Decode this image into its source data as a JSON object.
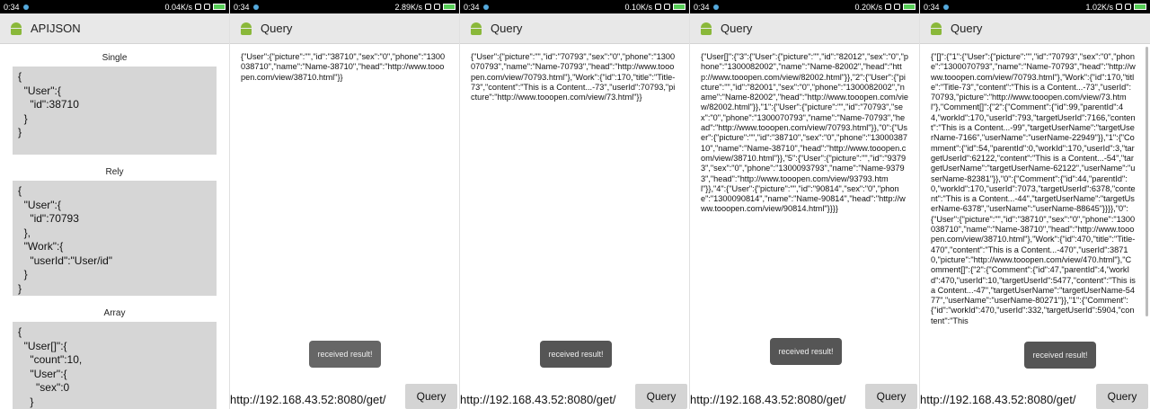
{
  "status": [
    {
      "time": "0:34",
      "net": "0.04K/s"
    },
    {
      "time": "0:34",
      "net": "2.89K/s"
    },
    {
      "time": "0:34",
      "net": "0.10K/s"
    },
    {
      "time": "0:34",
      "net": "0.20K/s"
    },
    {
      "time": "0:34",
      "net": "1.02K/s"
    }
  ],
  "main": {
    "title": "APIJSON",
    "sections": [
      {
        "label": "Single",
        "code": "{\n  \"User\":{\n    \"id\":38710\n  }\n}"
      },
      {
        "label": "Rely",
        "code": "{\n  \"User\":{\n    \"id\":70793\n  },\n  \"Work\":{\n    \"userId\":\"User/id\"\n  }\n}"
      },
      {
        "label": "Array",
        "code": "{\n  \"User[]\":{\n    \"count\":10,\n    \"User\":{\n      \"sex\":0\n    }"
      }
    ]
  },
  "query_screens": [
    {
      "title": "Query",
      "result": "{\"User\":{\"picture\":\"\",\"id\":\"38710\",\"sex\":\"0\",\"phone\":\"1300038710\",\"name\":\"Name-38710\",\"head\":\"http://www.tooopen.com/view/38710.html\"}}",
      "toast": "received result!",
      "url": "http://192.168.43.52:8080/get/",
      "button": "Query"
    },
    {
      "title": "Query",
      "result": "{\"User\":{\"picture\":\"\",\"id\":\"70793\",\"sex\":\"0\",\"phone\":\"1300070793\",\"name\":\"Name-70793\",\"head\":\"http://www.tooopen.com/view/70793.html\"},\"Work\":{\"id\":170,\"title\":\"Title-73\",\"content\":\"This is a Content...-73\",\"userId\":70793,\"picture\":\"http://www.tooopen.com/view/73.html\"}}",
      "toast": "received result!",
      "url": "http://192.168.43.52:8080/get/",
      "button": "Query"
    },
    {
      "title": "Query",
      "result": "{\"User[]\":{\"3\":{\"User\":{\"picture\":\"\",\"id\":\"82012\",\"sex\":\"0\",\"phone\":\"1300082002\",\"name\":\"Name-82002\",\"head\":\"http://www.tooopen.com/view/82002.html\"}},\"2\":{\"User\":{\"picture\":\"\",\"id\":\"82001\",\"sex\":\"0\",\"phone\":\"1300082002\",\"name\":\"Name-82002\",\"head\":\"http://www.tooopen.com/view/82002.html\"}},\"1\":{\"User\":{\"picture\":\"\",\"id\":\"70793\",\"sex\":\"0\",\"phone\":\"1300070793\",\"name\":\"Name-70793\",\"head\":\"http://www.tooopen.com/view/70793.html\"}},\"0\":{\"User\":{\"picture\":\"\",\"id\":\"38710\",\"sex\":\"0\",\"phone\":\"1300038710\",\"name\":\"Name-38710\",\"head\":\"http://www.tooopen.com/view/38710.html\"}},\"5\":{\"User\":{\"picture\":\"\",\"id\":\"93793\",\"sex\":\"0\",\"phone\":\"1300093793\",\"name\":\"Name-93793\",\"head\":\"http://www.tooopen.com/view/93793.html\"}},\"4\":{\"User\":{\"picture\":\"\",\"id\":\"90814\",\"sex\":\"0\",\"phone\":\"1300090814\",\"name\":\"Name-90814\",\"head\":\"http://www.tooopen.com/view/90814.html\"}}}}",
      "toast": "received result!",
      "url": "http://192.168.43.52:8080/get/",
      "button": "Query"
    },
    {
      "title": "Query",
      "result": "{\"[]\":{\"1\":{\"User\":{\"picture\":\"\",\"id\":\"70793\",\"sex\":\"0\",\"phone\":\"1300070793\",\"name\":\"Name-70793\",\"head\":\"http://www.tooopen.com/view/70793.html\"},\"Work\":{\"id\":170,\"title\":\"Title-73\",\"content\":\"This is a Content...-73\",\"userId\":70793,\"picture\":\"http://www.tooopen.com/view/73.html\"},\"Comment[]\":{\"2\":{\"Comment\":{\"id\":99,\"parentId\":44,\"workId\":170,\"userId\":793,\"targetUserId\":7166,\"content\":\"This is a Content...-99\",\"targetUserName\":\"targetUserName-7166\",\"userName\":\"userName-22949\"}},\"1\":{\"Comment\":{\"id\":54,\"parentId\":0,\"workId\":170,\"userId\":3,\"targetUserId\":62122,\"content\":\"This is a Content...-54\",\"targetUserName\":\"targetUserName-62122\",\"userName\":\"userName-82381\"}},\"0\":{\"Comment\":{\"id\":44,\"parentId\":0,\"workId\":170,\"userId\":7073,\"targetUserId\":6378,\"content\":\"This is a Content...-44\",\"targetUserName\":\"targetUserName-6378\",\"userName\":\"userName-88645\"}}}},\"0\":{\"User\":{\"picture\":\"\",\"id\":\"38710\",\"sex\":\"0\",\"phone\":\"1300038710\",\"name\":\"Name-38710\",\"head\":\"http://www.tooopen.com/view/38710.html\"},\"Work\":{\"id\":470,\"title\":\"Title-470\",\"content\":\"This is a Content...-470\",\"userId\":38710,\"picture\":\"http://www.tooopen.com/view/470.html\"},\"Comment[]\":{\"2\":{\"Comment\":{\"id\":47,\"parentId\":4,\"workId\":470,\"userId\":10,\"targetUserId\":5477,\"content\":\"This is a Content...-47\",\"targetUserName\":\"targetUserName-5477\",\"userName\":\"userName-80271\"}},\"1\":{\"Comment\":{\"id\":\"workId\":470,\"userId\":332,\"targetUserId\":5904,\"content\":\"This",
      "toast": "received result!",
      "url": "http://192.168.43.52:8080/get/",
      "button": "Query"
    }
  ],
  "colors": {
    "android_green": "#8ab83a",
    "toast_bg": "#666666",
    "codebox_bg": "#d6d6d6"
  }
}
